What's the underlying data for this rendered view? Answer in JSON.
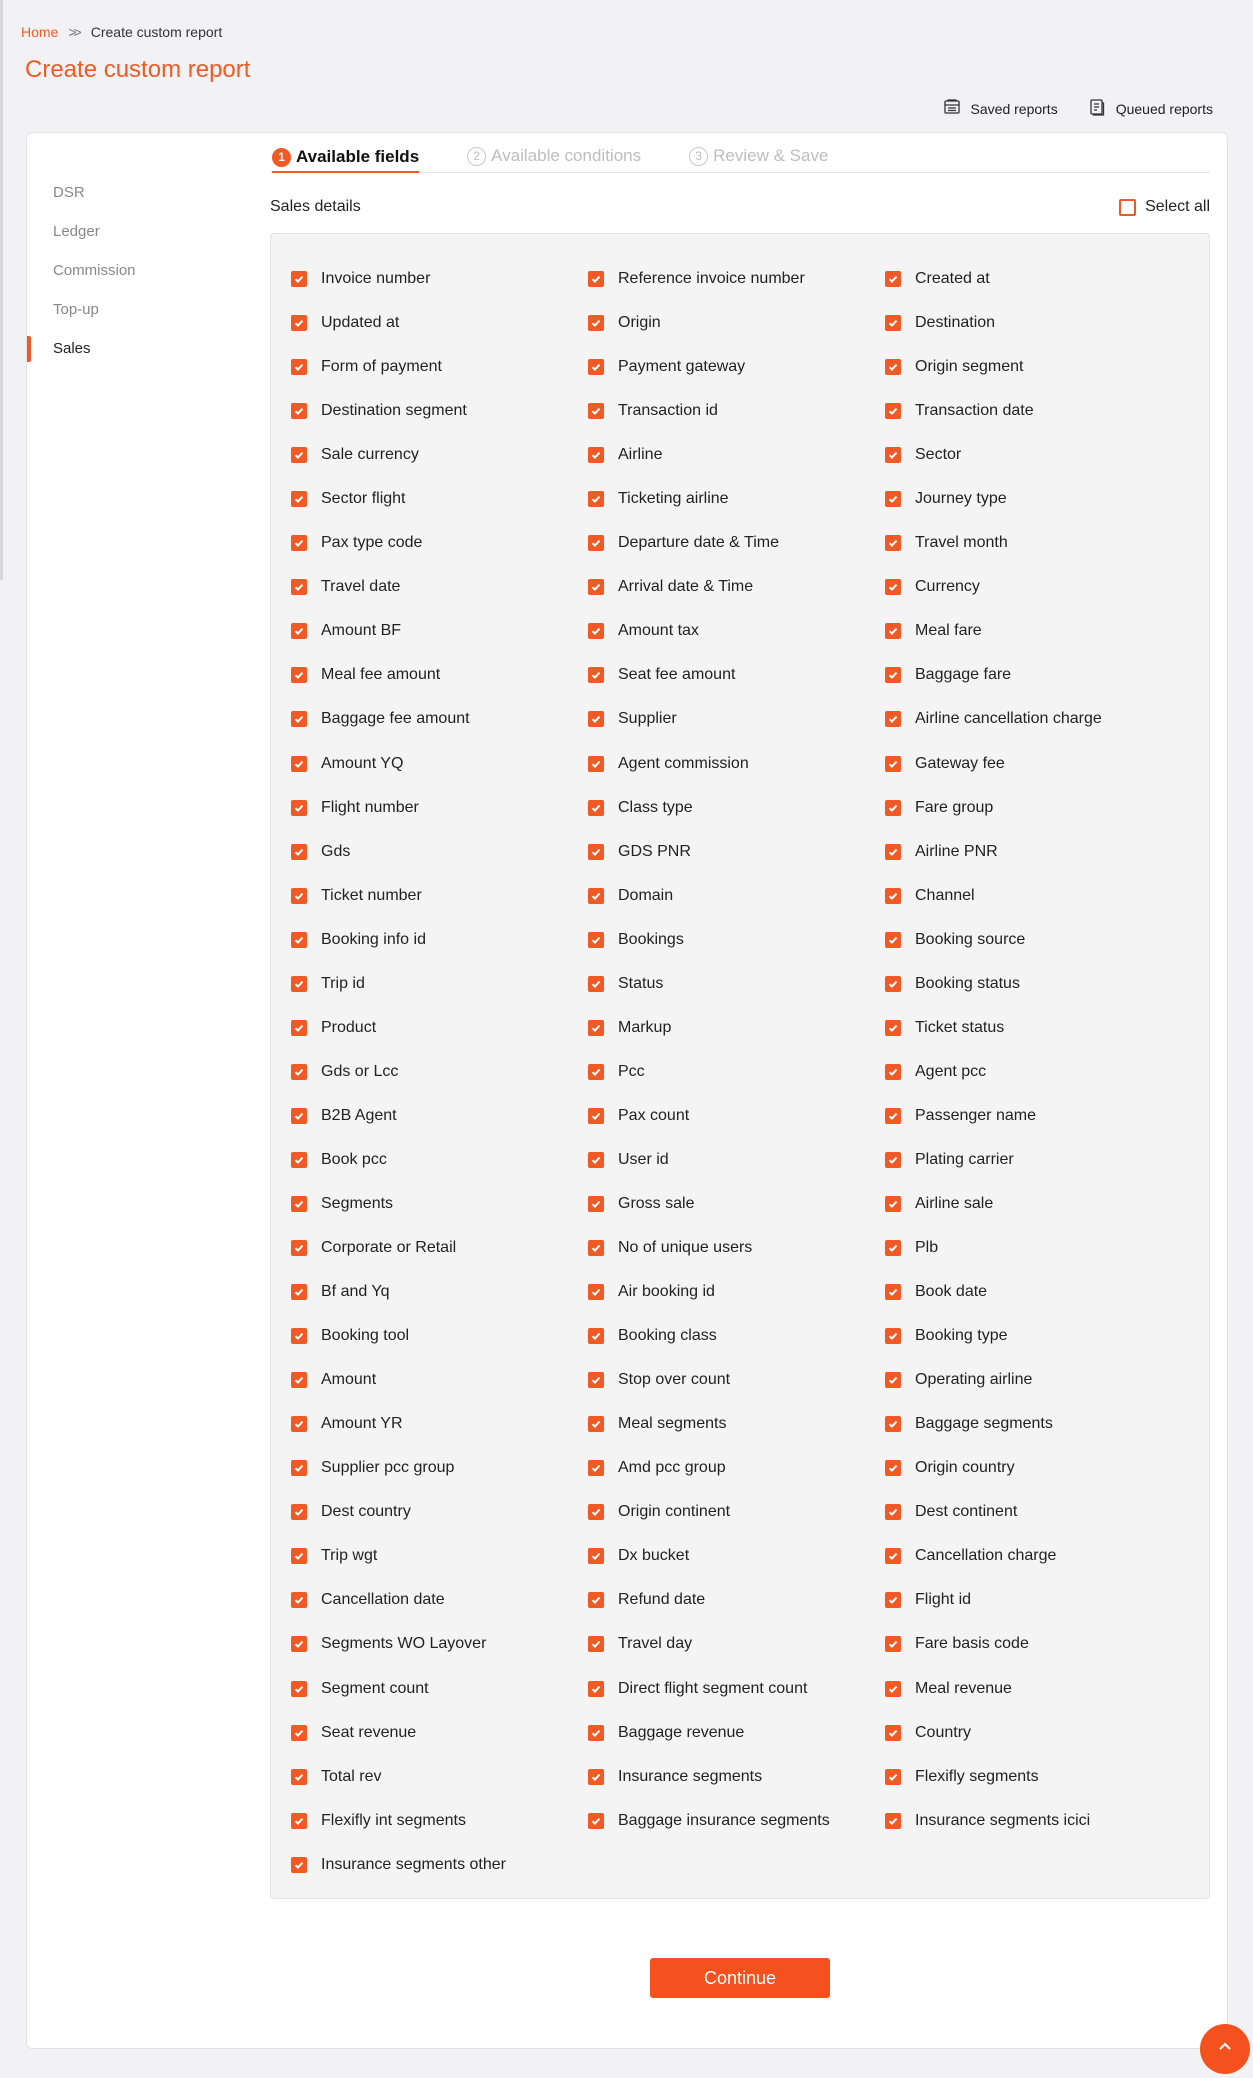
{
  "breadcrumb": {
    "home": "Home",
    "separator": ">>",
    "current": "Create custom report"
  },
  "page_title": "Create custom report",
  "actions": {
    "saved_reports": "Saved reports",
    "queued_reports": "Queued reports"
  },
  "sidebar": {
    "items": [
      {
        "label": "DSR",
        "active": false
      },
      {
        "label": "Ledger",
        "active": false
      },
      {
        "label": "Commission",
        "active": false
      },
      {
        "label": "Top-up",
        "active": false
      },
      {
        "label": "Sales",
        "active": true
      }
    ]
  },
  "steps": [
    {
      "num": "1",
      "label": "Available fields",
      "active": true
    },
    {
      "num": "2",
      "label": "Available conditions",
      "active": false
    },
    {
      "num": "3",
      "label": "Review & Save",
      "active": false
    }
  ],
  "section": {
    "title": "Sales details",
    "select_all": "Select all",
    "select_all_checked": false
  },
  "fields": [
    "Invoice number",
    "Reference invoice number",
    "Created at",
    "Updated at",
    "Origin",
    "Destination",
    "Form of payment",
    "Payment gateway",
    "Origin segment",
    "Destination segment",
    "Transaction id",
    "Transaction date",
    "Sale currency",
    "Airline",
    "Sector",
    "Sector flight",
    "Ticketing airline",
    "Journey type",
    "Pax type code",
    "Departure date & Time",
    "Travel month",
    "Travel date",
    "Arrival date & Time",
    "Currency",
    "Amount BF",
    "Amount tax",
    "Meal fare",
    "Meal fee amount",
    "Seat fee amount",
    "Baggage fare",
    "Baggage fee amount",
    "Supplier",
    "Airline cancellation charge",
    "Amount YQ",
    "Agent commission",
    "Gateway fee",
    "Flight number",
    "Class type",
    "Fare group",
    "Gds",
    "GDS PNR",
    "Airline PNR",
    "Ticket number",
    "Domain",
    "Channel",
    "Booking info id",
    "Bookings",
    "Booking source",
    "Trip id",
    "Status",
    "Booking status",
    "Product",
    "Markup",
    "Ticket status",
    "Gds or Lcc",
    "Pcc",
    "Agent pcc",
    "B2B Agent",
    "Pax count",
    "Passenger name",
    "Book pcc",
    "User id",
    "Plating carrier",
    "Segments",
    "Gross sale",
    "Airline sale",
    "Corporate or Retail",
    "No of unique users",
    "Plb",
    "Bf and Yq",
    "Air booking id",
    "Book date",
    "Booking tool",
    "Booking class",
    "Booking type",
    "Amount",
    "Stop over count",
    "Operating airline",
    "Amount YR",
    "Meal segments",
    "Baggage segments",
    "Supplier pcc group",
    "Amd pcc group",
    "Origin country",
    "Dest country",
    "Origin continent",
    "Dest continent",
    "Trip wgt",
    "Dx bucket",
    "Cancellation charge",
    "Cancellation date",
    "Refund date",
    "Flight id",
    "Segments WO Layover",
    "Travel day",
    "Fare basis code",
    "Segment count",
    "Direct flight segment count",
    "Meal revenue",
    "Seat revenue",
    "Baggage revenue",
    "Country",
    "Total rev",
    "Insurance segments",
    "Flexifly segments",
    "Flexifly int segments",
    "Baggage insurance segments",
    "Insurance segments icici",
    "Insurance segments other"
  ],
  "fields_checked": true,
  "continue_label": "Continue",
  "colors": {
    "accent": "#f15a24",
    "button": "#f4511e"
  },
  "icons": {
    "saved_reports": "saved-reports-icon",
    "queued_reports": "queued-reports-icon",
    "scroll_top": "chevron-up-icon"
  }
}
